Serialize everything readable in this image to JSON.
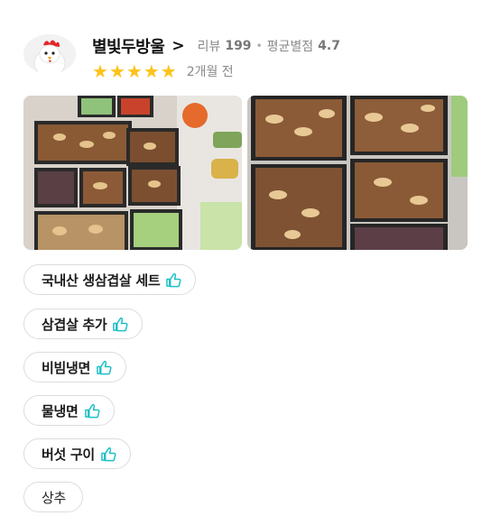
{
  "review": {
    "nickname": "별빛두방울",
    "chevron": ">",
    "review_label": "리뷰",
    "review_count": "199",
    "separator": "•",
    "avg_label": "평균별점",
    "avg_rating": "4.7",
    "stars": 5,
    "date": "2개월 전",
    "photos": [
      {
        "name": "review-photo-1"
      },
      {
        "name": "review-photo-2"
      }
    ]
  },
  "tags": [
    {
      "label": "국내산 생삼겹살 세트",
      "liked": true
    },
    {
      "label": "삼겹살 추가",
      "liked": true
    },
    {
      "label": "비빔냉면",
      "liked": true
    },
    {
      "label": "물냉면",
      "liked": true
    },
    {
      "label": "버섯 구이",
      "liked": true
    },
    {
      "label": "상추",
      "liked": false
    }
  ],
  "colors": {
    "star": "#ffc21a",
    "thumb": "#1ec0c8",
    "tag_border": "#dcdcdc",
    "muted_text": "#8a8a8a"
  },
  "icons": {
    "avatar": "chicken-avatar-icon",
    "star": "star-icon",
    "like": "thumbs-up-icon"
  }
}
